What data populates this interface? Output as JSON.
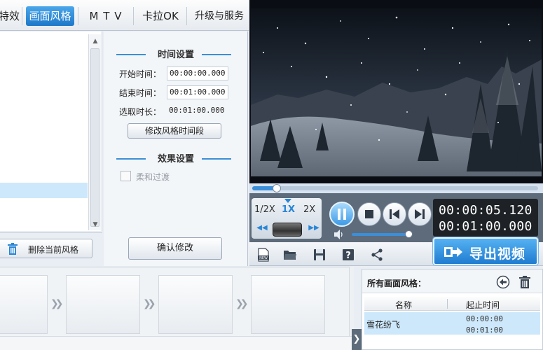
{
  "tabs": {
    "effects_partial": "特效",
    "style": "画面风格",
    "mtv": "M T V",
    "karaoke": "卡拉OK",
    "upgrade": "升级与服务"
  },
  "time_settings": {
    "title": "时间设置",
    "start_label": "开始时间：",
    "start_value": "00:00:00.000",
    "end_label": "结束时间：",
    "end_value": "00:01:00.000",
    "duration_label": "选取时长：",
    "duration_value": "00:01:00.000",
    "modify_period_button": "修改风格时间段"
  },
  "effect_settings": {
    "title": "效果设置",
    "smooth_transition_label": "柔和过渡",
    "smooth_transition_checked": false
  },
  "confirm_button": "确认修改",
  "delete_style_button": "删除当前风格",
  "playback": {
    "speeds": [
      "1/2X",
      "1X",
      "2X"
    ],
    "selected_speed": "1X",
    "current_time": "00:00:05.120",
    "total_time": "00:01:00.000",
    "progress": 0.0853
  },
  "export_button": "导出视频",
  "all_styles": {
    "title": "所有画面风格：",
    "col_name": "名称",
    "col_range": "起止时间",
    "rows": [
      {
        "name": "雪花纷飞",
        "start": "00:00:00",
        "end": "00:01:00"
      }
    ]
  },
  "colors": {
    "accent": "#2a86d6",
    "tab_active": "#1d78c9",
    "selection": "#cde8fb",
    "time_display_bg": "#1e2226"
  }
}
